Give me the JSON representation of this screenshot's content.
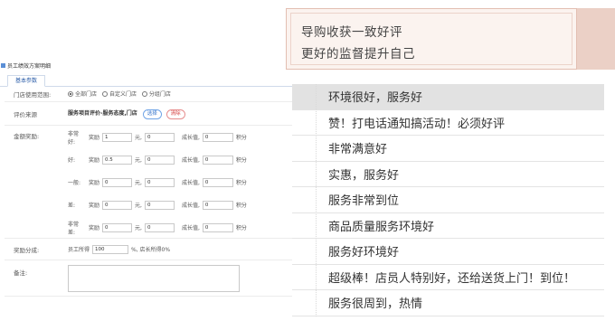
{
  "form": {
    "title": "员工绩效方案明细",
    "tab": "基本参数",
    "scope": {
      "label": "门店使用范围:",
      "options": [
        "全部门店",
        "自定义门店",
        "分组门店"
      ]
    },
    "source": {
      "label": "评价来源",
      "value": "服务项目评价-服务态度,门店",
      "select_btn": "选择",
      "clear_btn": "清除"
    },
    "reward": {
      "label": "金额奖励:",
      "award_label": "奖励",
      "unit_yuan": "元,",
      "growth_label": "成长值,",
      "unit_points": "积分",
      "levels": [
        {
          "name": "非常好:",
          "amount": "1",
          "growth": "0",
          "points": "0"
        },
        {
          "name": "好:",
          "amount": "0.5",
          "growth": "0",
          "points": "0"
        },
        {
          "name": "一般:",
          "amount": "0",
          "growth": "0",
          "points": "0"
        },
        {
          "name": "差:",
          "amount": "0",
          "growth": "0",
          "points": "0"
        },
        {
          "name": "非常差:",
          "amount": "0",
          "growth": "0",
          "points": "0"
        }
      ]
    },
    "share": {
      "label": "奖励分成:",
      "staff_label": "员工所得",
      "staff_value": "100",
      "suffix": "%, 店长所得0%"
    },
    "note": {
      "label": "备注:"
    }
  },
  "banner": {
    "line1": "导购收获一致好评",
    "line2": "更好的监督提升自己"
  },
  "reviews": [
    "环境很好，服务好",
    "赞！打电话通知搞活动！必须好评",
    "非常满意好",
    "实惠，服务好",
    "服务非常到位",
    "商品质量服务环境好",
    "服务好环境好",
    "超级棒！店员人特别好，还给送货上门！到位！",
    "服务很周到，热情"
  ]
}
